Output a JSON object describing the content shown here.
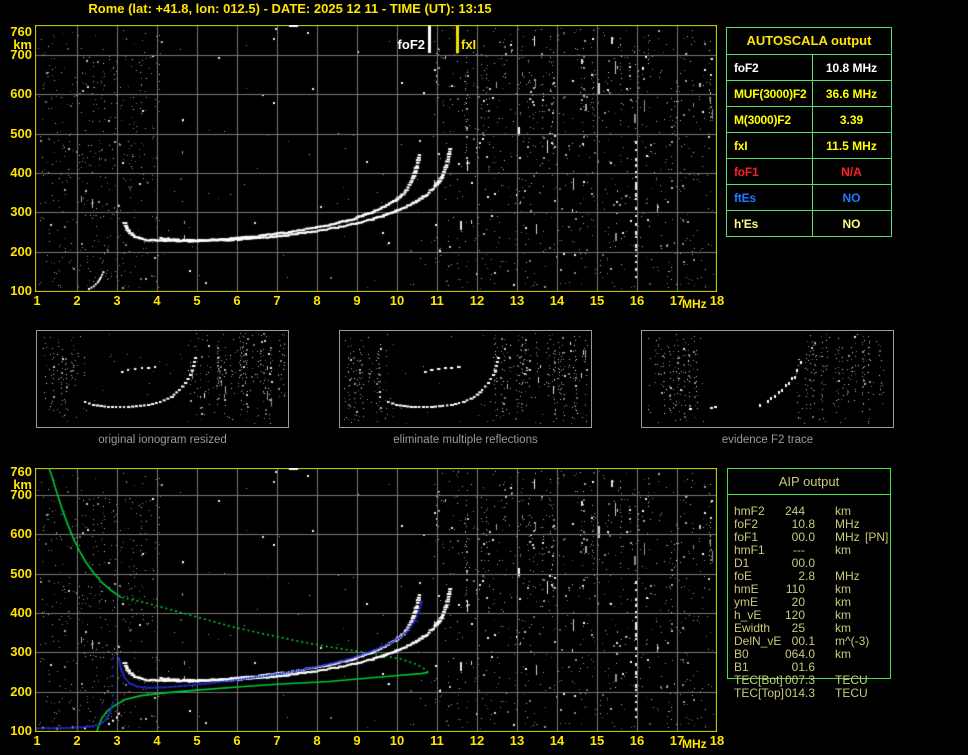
{
  "title": "Rome (lat: +41.8, lon: 012.5) - DATE: 2025 12 11 - TIME (UT): 13:15",
  "colors": {
    "axis_text": "#FFE600",
    "plot_border": "#D8D800",
    "grid": "#787878",
    "autoscala_border": "#55DC70",
    "aip_border": "#44E444",
    "aip_text": "#C9C97D",
    "caption_text": "#9A9A9A",
    "trace_white": "#FFFFFF",
    "trace_blue": "#2230D8",
    "profile_green": "#00C832",
    "marker_foF2_color": "#FFFFFF",
    "marker_fxI_color": "#F5E400"
  },
  "autoscala_table": {
    "header": "AUTOSCALA output",
    "rows": [
      {
        "label": "foF2",
        "value": "10.8 MHz",
        "color": "#FFFFFF"
      },
      {
        "label": "MUF(3000)F2",
        "value": "36.6 MHz",
        "color": "#FFFF00"
      },
      {
        "label": "M(3000)F2",
        "value": "3.39",
        "color": "#FFFF00"
      },
      {
        "label": "fxI",
        "value": "11.5 MHz",
        "color": "#FFFF00"
      },
      {
        "label": "foF1",
        "value": "N/A",
        "color": "#FF2020"
      },
      {
        "label": "ftEs",
        "value": "NO",
        "color": "#1E7BFF"
      },
      {
        "label": "h'Es",
        "value": "NO",
        "color": "#FFFF80"
      }
    ]
  },
  "aip_table": {
    "header": "AIP output",
    "rows": [
      {
        "label": "hmF2",
        "value": "244",
        "unit": "km",
        "note": ""
      },
      {
        "label": "foF2",
        "value": "10.8",
        "unit": "MHz",
        "note": ""
      },
      {
        "label": "foF1",
        "value": "00.0",
        "unit": "MHz",
        "note": "[PN]"
      },
      {
        "label": "hmF1",
        "value": "---",
        "unit": "km",
        "note": ""
      },
      {
        "label": "D1",
        "value": "00.0",
        "unit": "",
        "note": ""
      },
      {
        "label": "foE",
        "value": "2.8",
        "unit": "MHz",
        "note": ""
      },
      {
        "label": "hmE",
        "value": "110",
        "unit": "km",
        "note": ""
      },
      {
        "label": "ymE",
        "value": "20",
        "unit": "km",
        "note": ""
      },
      {
        "label": "h_vE",
        "value": "120",
        "unit": "km",
        "note": ""
      },
      {
        "label": "Ewidth",
        "value": "25",
        "unit": "km",
        "note": ""
      },
      {
        "label": "DelN_vE",
        "value": "00.1",
        "unit": "m^(-3)",
        "note": ""
      },
      {
        "label": "B0",
        "value": "064.0",
        "unit": "km",
        "note": ""
      },
      {
        "label": "B1",
        "value": "01.6",
        "unit": "",
        "note": ""
      },
      {
        "label": "TEC[Bot]",
        "value": "007.3",
        "unit": "TECU",
        "note": ""
      },
      {
        "label": "TEC[Top]",
        "value": "014.3",
        "unit": "TECU",
        "note": ""
      }
    ]
  },
  "thumbnails": [
    {
      "caption": "original ionogram resized"
    },
    {
      "caption": "eliminate multiple reflections"
    },
    {
      "caption": "evidence F2 trace"
    }
  ],
  "chart_data": [
    {
      "id": "scaled_ionogram",
      "type": "scatter",
      "xlabel": "MHz",
      "ylabel": "km",
      "xlim": [
        1,
        18
      ],
      "ylim": [
        100,
        760
      ],
      "xticks": [
        "1",
        "2",
        "3",
        "4",
        "5",
        "6",
        "7",
        "8",
        "9",
        "10",
        "11",
        "12",
        "13",
        "14",
        "15",
        "16",
        "17",
        "18"
      ],
      "yticks": [
        "760",
        "700",
        "600",
        "500",
        "400",
        "300",
        "200",
        "100"
      ],
      "grid": true,
      "markers": [
        {
          "label": "foF2",
          "f": 10.8
        },
        {
          "label": "fxI",
          "f": 11.5
        }
      ],
      "series": [
        {
          "name": "o-trace",
          "color": "#FFFFFF",
          "style": "trace",
          "points": [
            [
              3.2,
              272
            ],
            [
              3.3,
              250
            ],
            [
              3.45,
              238
            ],
            [
              3.7,
              230
            ],
            [
              4.2,
              227
            ],
            [
              4.8,
              227
            ],
            [
              5.4,
              230
            ],
            [
              6.0,
              234
            ],
            [
              6.6,
              240
            ],
            [
              7.2,
              248
            ],
            [
              7.8,
              258
            ],
            [
              8.4,
              270
            ],
            [
              8.9,
              283
            ],
            [
              9.3,
              297
            ],
            [
              9.7,
              315
            ],
            [
              10.0,
              333
            ],
            [
              10.2,
              352
            ],
            [
              10.35,
              375
            ],
            [
              10.45,
              400
            ],
            [
              10.52,
              425
            ],
            [
              10.56,
              445
            ]
          ]
        },
        {
          "name": "x-trace",
          "color": "#FFFFFF",
          "style": "trace",
          "points": [
            [
              4.1,
              234
            ],
            [
              4.6,
              229
            ],
            [
              5.1,
              228
            ],
            [
              5.7,
              229
            ],
            [
              6.3,
              233
            ],
            [
              6.9,
              238
            ],
            [
              7.5,
              245
            ],
            [
              8.1,
              254
            ],
            [
              8.7,
              265
            ],
            [
              9.2,
              277
            ],
            [
              9.7,
              292
            ],
            [
              10.1,
              308
            ],
            [
              10.45,
              325
            ],
            [
              10.75,
              345
            ],
            [
              10.95,
              365
            ],
            [
              11.1,
              385
            ],
            [
              11.2,
              408
            ],
            [
              11.28,
              435
            ],
            [
              11.33,
              460
            ]
          ]
        },
        {
          "name": "E-trace-fragment",
          "color": "#FFFFFF",
          "style": "dots",
          "points": [
            [
              2.3,
              105
            ],
            [
              2.42,
              112
            ],
            [
              2.52,
              122
            ],
            [
              2.6,
              135
            ],
            [
              2.66,
              148
            ]
          ]
        }
      ]
    },
    {
      "id": "aip_ionogram",
      "type": "scatter",
      "xlabel": "MHz",
      "ylabel": "km",
      "xlim": [
        1,
        18
      ],
      "ylim": [
        100,
        760
      ],
      "xticks": [
        "1",
        "2",
        "3",
        "4",
        "5",
        "6",
        "7",
        "8",
        "9",
        "10",
        "11",
        "12",
        "13",
        "14",
        "15",
        "16",
        "17",
        "18"
      ],
      "yticks": [
        "760",
        "700",
        "600",
        "500",
        "400",
        "300",
        "200",
        "100"
      ],
      "grid": true,
      "series": [
        {
          "name": "profile-bottomside",
          "color": "#00C832",
          "style": "line",
          "points": [
            [
              2.5,
              100
            ],
            [
              2.55,
              115
            ],
            [
              2.62,
              133
            ],
            [
              2.75,
              150
            ],
            [
              2.9,
              162
            ],
            [
              3.2,
              180
            ],
            [
              3.6,
              190
            ],
            [
              4.2,
              197
            ],
            [
              5.0,
              204
            ],
            [
              6.0,
              212
            ],
            [
              7.0,
              219
            ],
            [
              8.3,
              226
            ],
            [
              9.3,
              235
            ],
            [
              10.1,
              242
            ],
            [
              10.6,
              246
            ],
            [
              10.78,
              249
            ]
          ]
        },
        {
          "name": "profile-topside-dotted",
          "color": "#00C832",
          "style": "dotted",
          "points": [
            [
              10.78,
              249
            ],
            [
              10.65,
              261
            ],
            [
              10.45,
              271
            ],
            [
              10.1,
              283
            ],
            [
              9.6,
              293
            ],
            [
              9.0,
              303
            ],
            [
              8.3,
              314
            ],
            [
              7.6,
              327
            ],
            [
              7.0,
              340
            ],
            [
              6.0,
              362
            ],
            [
              5.1,
              387
            ],
            [
              4.3,
              410
            ],
            [
              3.65,
              428
            ],
            [
              3.1,
              440
            ]
          ]
        },
        {
          "name": "profile-topside-solid",
          "color": "#00C832",
          "style": "line",
          "points": [
            [
              3.1,
              440
            ],
            [
              2.85,
              458
            ],
            [
              2.62,
              478
            ],
            [
              2.42,
              502
            ],
            [
              2.22,
              530
            ],
            [
              2.05,
              560
            ],
            [
              1.9,
              592
            ],
            [
              1.77,
              625
            ],
            [
              1.65,
              658
            ],
            [
              1.53,
              695
            ],
            [
              1.43,
              728
            ],
            [
              1.35,
              755
            ],
            [
              1.3,
              768
            ]
          ]
        },
        {
          "name": "o-trace",
          "color": "#FFFFFF",
          "style": "trace",
          "points": [
            [
              3.2,
              272
            ],
            [
              3.3,
              250
            ],
            [
              3.45,
              238
            ],
            [
              3.7,
              230
            ],
            [
              4.2,
              227
            ],
            [
              4.8,
              227
            ],
            [
              5.4,
              230
            ],
            [
              6.0,
              234
            ],
            [
              6.6,
              240
            ],
            [
              7.2,
              248
            ],
            [
              7.8,
              258
            ],
            [
              8.4,
              270
            ],
            [
              8.9,
              283
            ],
            [
              9.3,
              297
            ],
            [
              9.7,
              315
            ],
            [
              10.0,
              333
            ],
            [
              10.2,
              352
            ],
            [
              10.35,
              375
            ],
            [
              10.45,
              400
            ],
            [
              10.52,
              425
            ],
            [
              10.56,
              445
            ]
          ]
        },
        {
          "name": "x-trace",
          "color": "#FFFFFF",
          "style": "trace",
          "points": [
            [
              4.1,
              234
            ],
            [
              4.6,
              229
            ],
            [
              5.1,
              228
            ],
            [
              5.7,
              229
            ],
            [
              6.3,
              233
            ],
            [
              6.9,
              238
            ],
            [
              7.5,
              245
            ],
            [
              8.1,
              254
            ],
            [
              8.7,
              265
            ],
            [
              9.2,
              277
            ],
            [
              9.7,
              292
            ],
            [
              10.1,
              308
            ],
            [
              10.45,
              325
            ],
            [
              10.75,
              345
            ],
            [
              10.95,
              365
            ],
            [
              11.1,
              385
            ],
            [
              11.2,
              408
            ],
            [
              11.28,
              435
            ],
            [
              11.33,
              460
            ]
          ]
        },
        {
          "name": "E-white-fragment",
          "color": "#FFFFFF",
          "style": "sparse",
          "points": [
            [
              1.15,
              108
            ],
            [
              1.5,
              106
            ],
            [
              1.9,
              109
            ],
            [
              2.2,
              107
            ],
            [
              2.8,
              118
            ],
            [
              2.9,
              126
            ],
            [
              3.0,
              134
            ],
            [
              3.05,
              144
            ]
          ]
        },
        {
          "name": "restored-E-trace",
          "color": "#2230D8",
          "style": "dots",
          "points": [
            [
              1.0,
              107
            ],
            [
              1.6,
              107
            ],
            [
              2.1,
              109
            ],
            [
              2.4,
              112
            ],
            [
              2.6,
              118
            ],
            [
              2.75,
              132
            ],
            [
              2.84,
              152
            ],
            [
              2.9,
              172
            ]
          ]
        },
        {
          "name": "restored-cusp",
          "color": "#2230D8",
          "style": "sparse",
          "points": [
            [
              2.9,
              190
            ],
            [
              2.88,
              215
            ],
            [
              2.9,
              240
            ],
            [
              2.89,
              262
            ],
            [
              2.9,
              285
            ],
            [
              2.88,
              300
            ]
          ]
        },
        {
          "name": "restored-F-trace",
          "color": "#2230D8",
          "style": "dots",
          "points": [
            [
              3.05,
              285
            ],
            [
              3.1,
              258
            ],
            [
              3.18,
              238
            ],
            [
              3.3,
              222
            ],
            [
              3.5,
              213
            ],
            [
              3.8,
              210
            ],
            [
              4.2,
              211
            ],
            [
              4.7,
              215
            ],
            [
              5.2,
              220
            ],
            [
              5.7,
              226
            ],
            [
              6.2,
              233
            ],
            [
              6.7,
              240
            ],
            [
              7.2,
              248
            ],
            [
              7.7,
              257
            ],
            [
              8.2,
              268
            ],
            [
              8.7,
              280
            ],
            [
              9.1,
              293
            ],
            [
              9.5,
              308
            ],
            [
              9.85,
              324
            ],
            [
              10.1,
              340
            ],
            [
              10.3,
              358
            ],
            [
              10.45,
              380
            ],
            [
              10.55,
              405
            ],
            [
              10.62,
              428
            ]
          ]
        }
      ]
    }
  ]
}
